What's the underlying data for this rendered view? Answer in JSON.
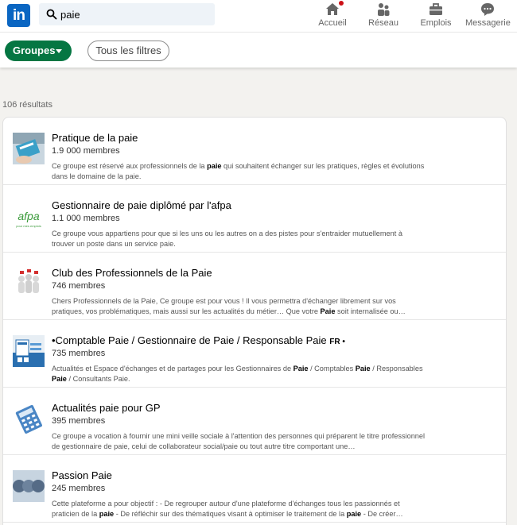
{
  "nav": {
    "logo_text": "in",
    "search_value": "paie",
    "items": [
      {
        "label": "Accueil",
        "icon": "home-icon"
      },
      {
        "label": "Réseau",
        "icon": "network-icon"
      },
      {
        "label": "Emplois",
        "icon": "briefcase-icon"
      },
      {
        "label": "Messagerie",
        "icon": "message-icon"
      }
    ]
  },
  "filters": {
    "groupes_label": "Groupes",
    "tous_filtres_label": "Tous les filtres"
  },
  "results": {
    "count_label": "106 résultats",
    "items": [
      {
        "title": "Pratique de la paie",
        "members": "1.9 000 membres",
        "desc_parts": [
          "Ce groupe est réservé aux professionnels de la ",
          "paie",
          " qui souhaitent échanger sur les pratiques, règles et évolutions dans le domaine de la paie."
        ]
      },
      {
        "title": "Gestionnaire de paie diplômé par l'afpa",
        "members": "1.1 000 membres",
        "desc_parts": [
          "Ce groupe vous appartiens pour que si les uns ou les autres on a des pistes pour s'entraider mutuellement à trouver un poste dans un service paie."
        ]
      },
      {
        "title": "Club des Professionnels de la Paie",
        "members": "746 membres",
        "desc_parts": [
          "Chers Professionnels de la Paie, Ce groupe est pour vous ! Il vous permettra d'échanger librement sur vos pratiques, vos problématiques, mais aussi sur les actualités du métier… Que votre ",
          "Paie",
          " soit internalisée ou…"
        ]
      },
      {
        "title": "•Comptable Paie / Gestionnaire de Paie / Responsable Paie",
        "title_suffix": "FR •",
        "members": "735 membres",
        "desc_parts": [
          "Actualités et Espace d'échanges et de partages pour les Gestionnaires de ",
          "Paie",
          " / Comptables ",
          "Paie",
          " / Responsables ",
          "Paie",
          " / Consultants Paie."
        ]
      },
      {
        "title": "Actualités paie pour GP",
        "members": "395 membres",
        "desc_parts": [
          "Ce groupe a vocation à fournir une mini veille sociale à l'attention des personnes qui préparent le titre professionnel de gestionnaire de paie, celui de collaborateur social/paie ou tout autre titre comportant une…"
        ]
      },
      {
        "title": "Passion Paie",
        "members": "245 membres",
        "desc_parts": [
          "Cette plateforme a pour objectif : - De regrouper autour d'une plateforme d'échanges tous les passionnés et praticien de la ",
          "paie",
          " - De réfléchir sur des thématiques visant à optimiser le traitement de la ",
          "paie",
          " - De créer…"
        ]
      }
    ]
  },
  "thumb_labels": {
    "afpa_logo": "afpa",
    "afpa_tagline": "pour mes emplois"
  },
  "colors": {
    "brand": "#0a66c2",
    "filter_active": "#057642",
    "notification": "#cc1016"
  }
}
